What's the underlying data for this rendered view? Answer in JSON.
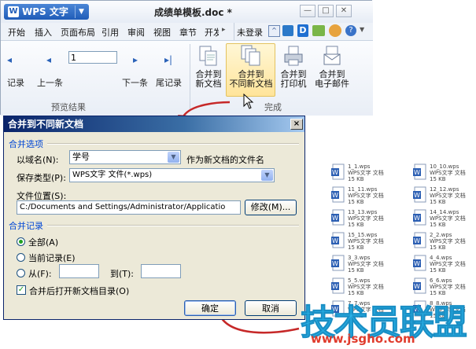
{
  "ribbon": {
    "app_name": "WPS 文字",
    "doc_title": "成绩单模板.doc *",
    "menu": [
      "开始",
      "插入",
      "页面布局",
      "引用",
      "审阅",
      "视图",
      "章节",
      "开发"
    ],
    "right_tools": {
      "login": "未登录"
    },
    "nav": {
      "prev_record_partial": "记录",
      "prev_item": "上一条",
      "record_value": "1",
      "next_item": "下一条",
      "last_record": "尾记录",
      "group_label": "预览结果"
    },
    "merge": {
      "new_doc": [
        "合并到",
        "新文档"
      ],
      "diff_new_doc": [
        "合并到",
        "不同新文档"
      ],
      "printer": [
        "合并到",
        "打印机"
      ],
      "email": [
        "合并到",
        "电子邮件"
      ],
      "group_label": "完成"
    }
  },
  "dialog": {
    "title": "合并到不同新文档",
    "close": "×",
    "section_merge_options": "合并选项",
    "field_name_label": "以域名(N):",
    "field_name_value": "学号",
    "field_name_suffix": "作为新文档的文件名",
    "save_type_label": "保存类型(P):",
    "save_type_value": "WPS文字 文件(*.wps)",
    "location_label": "文件位置(S):",
    "location_value": "C:/Documents and Settings/Administrator/Applicatio",
    "modify_button": "修改(M)...",
    "section_merge_records": "合并记录",
    "radio_all": "全部(A)",
    "radio_current": "当前记录(E)",
    "radio_from": "从(F):",
    "to_label": "到(T):",
    "open_after_merge": "合并后打开新文档目录(O)",
    "ok_button": "确定",
    "cancel_button": "取消"
  },
  "files": [
    {
      "name": "1_1.wps",
      "type": "WPS文字 文档",
      "size": "15 KB"
    },
    {
      "name": "10_10.wps",
      "type": "WPS文字 文档",
      "size": "15 KB"
    },
    {
      "name": "11_11.wps",
      "type": "WPS文字 文档",
      "size": "15 KB"
    },
    {
      "name": "12_12.wps",
      "type": "WPS文字 文档",
      "size": "15 KB"
    },
    {
      "name": "13_13.wps",
      "type": "WPS文字 文档",
      "size": "15 KB"
    },
    {
      "name": "14_14.wps",
      "type": "WPS文字 文档",
      "size": "15 KB"
    },
    {
      "name": "15_15.wps",
      "type": "WPS文字 文档",
      "size": "15 KB"
    },
    {
      "name": "2_2.wps",
      "type": "WPS文字 文档",
      "size": "15 KB"
    },
    {
      "name": "3_3.wps",
      "type": "WPS文字 文档",
      "size": "15 KB"
    },
    {
      "name": "4_4.wps",
      "type": "WPS文字 文档",
      "size": "15 KB"
    },
    {
      "name": "5_5.wps",
      "type": "WPS文字 文档",
      "size": "15 KB"
    },
    {
      "name": "6_6.wps",
      "type": "WPS文字 文档",
      "size": "15 KB"
    },
    {
      "name": "7_7.wps",
      "type": "WPS文字 文档",
      "size": "15 KB"
    },
    {
      "name": "8_8.wps",
      "type": "WPS文字 文档",
      "size": "15 KB"
    }
  ],
  "watermark": {
    "text": "技术员联盟",
    "url": "www.jsgho.com"
  },
  "colors": {
    "accent": "#1f5cb8",
    "dialog_title": "#0a246a",
    "arrow": "#c62828",
    "watermark": "#2ab4ea"
  }
}
